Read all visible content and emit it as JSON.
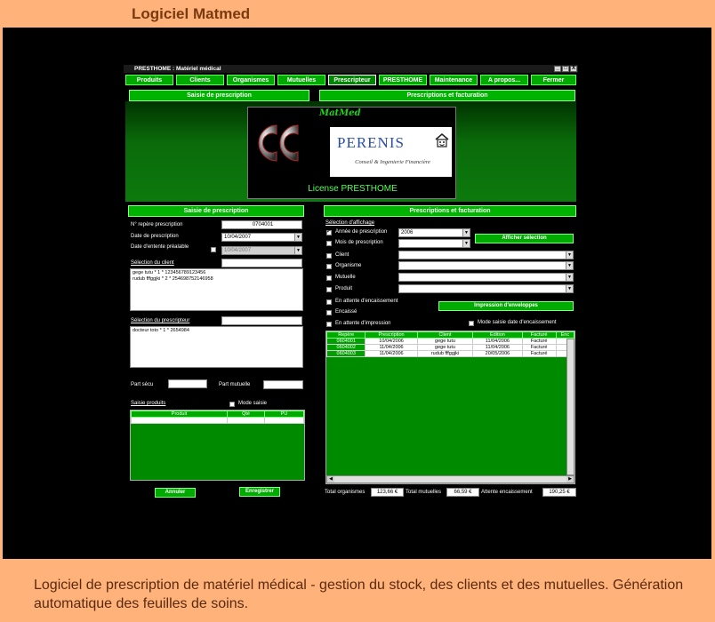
{
  "page_title": "Logiciel Matmed",
  "caption": "Logiciel de prescription de matériel médical - gestion du stock, des clients et des mutuelles. Génération automatique des feuilles de soins.",
  "window": {
    "title": "PRESTHOME : Matériel médical",
    "controls": [
      "_",
      "□",
      "X"
    ]
  },
  "menu": [
    "Produits",
    "Clients",
    "Organismes",
    "Mutuelles",
    "Prescripteur",
    "PRESTHOME",
    "Maintenance",
    "A propos...",
    "Fermer"
  ],
  "menu_active": "Prescripteur",
  "top_headers": {
    "left": "Saisie de prescription",
    "right": "Prescriptions et facturation"
  },
  "banner": {
    "matmed": "MatMed",
    "perenis": "PERENIS",
    "perenis_sub": "Conseil & Ingenierie Financière",
    "license": "License   PRESTHOME"
  },
  "left": {
    "header": "Saisie de prescription",
    "repere_label": "N° repère prescription",
    "repere_value": "0704001",
    "date_label": "Date de prescription",
    "date_value": "10/04/2007",
    "entente_label": "Date d'entente préalable",
    "entente_value": "10/04/2007",
    "client_label": "Sélection du client",
    "clients": [
      "gege tutu * 1 * 123456789123456",
      "rudub fffggjki * 2 * 254698752146958"
    ],
    "prescripteur_label": "Sélection du prescripteur",
    "prescripteurs": [
      "docteur toto * 1 * 2654984"
    ],
    "part_secu": "Part sécu",
    "part_mutuelle": "Part mutuelle",
    "saisie_produits": "Saisie produits",
    "mode_saisie": "Mode saisie",
    "product_columns": [
      "Produit",
      "Qté",
      "PU"
    ],
    "annuler": "Annuler",
    "enregistrer": "Enregistrer"
  },
  "right": {
    "header": "Prescriptions et facturation",
    "selection_affichage": "Sélection d'affichage",
    "annee_label": "Année de prescription",
    "annee_value": "2006",
    "mois_label": "Mois de prescription",
    "filters": [
      "Client",
      "Organisme",
      "Mutuelle",
      "Produit"
    ],
    "afficher": "Afficher sélection",
    "attente_encaissement": "En attente d'encaissement",
    "encaisse": "Encaissé",
    "impression_env": "Impression d'enveloppes",
    "attente_impression": "En attente d'impression",
    "mode_saisie_date": "Mode saisie date d'encaissement",
    "columns": [
      "Repère",
      "Prescription",
      "Client",
      "Edition",
      "Facturé",
      "Enc"
    ],
    "rows": [
      [
        "0604001",
        "10/04/2006",
        "gege tutu",
        "11/04/2006",
        "Facturé",
        ""
      ],
      [
        "0604002",
        "11/04/2006",
        "gege tutu",
        "11/04/2006",
        "Facturé",
        ""
      ],
      [
        "0604003",
        "11/04/2006",
        "rudub fffggjki",
        "20/05/2006",
        "Facturé",
        ""
      ]
    ],
    "total_org_label": "Total organismes",
    "total_org": "123,66 €",
    "total_mut_label": "Total mutuelles",
    "total_mut": "66,59 €",
    "attente_label": "Attente encaissement",
    "attente": "190,25 €"
  }
}
